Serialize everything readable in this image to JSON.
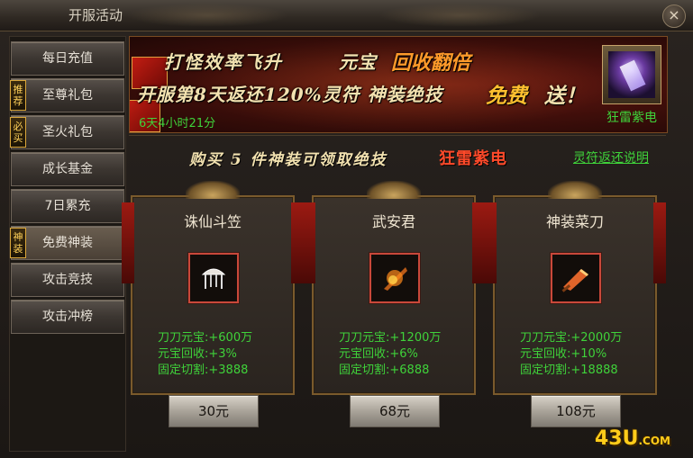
{
  "window": {
    "title": "开服活动",
    "close_glyph": "×"
  },
  "sidebar": {
    "items": [
      {
        "label": "每日充值",
        "badge": ""
      },
      {
        "label": "至尊礼包",
        "badge": "推荐"
      },
      {
        "label": "圣火礼包",
        "badge": "必买"
      },
      {
        "label": "成长基金",
        "badge": ""
      },
      {
        "label": "7日累充",
        "badge": ""
      },
      {
        "label": "免费神装",
        "badge": "神装"
      },
      {
        "label": "攻击竞技",
        "badge": ""
      },
      {
        "label": "攻击冲榜",
        "badge": ""
      }
    ]
  },
  "banner": {
    "line1_a": "打怪效率飞升",
    "line1_b": "元宝",
    "line1_c": "回收翻倍",
    "line2_a": "开服第8天返还120%灵符  神装绝技",
    "line2_b": "免费",
    "line2_c": "送！",
    "countdown": "6天4小时21分",
    "reward_name": "狂雷紫电",
    "reward_icon": "purple-crystal-icon"
  },
  "offer": {
    "line": "购买 5 件神装可领取绝技",
    "highlight": "狂雷紫电",
    "explain_link": "灵符返还说明"
  },
  "cards": [
    {
      "name": "诛仙斗笠",
      "icon": "hat-icon",
      "stats": [
        "刀刀元宝:+600万",
        "元宝回收:+3%",
        "固定切割:+3888"
      ],
      "price": "30元"
    },
    {
      "name": "武安君",
      "icon": "fire-weapon-icon",
      "stats": [
        "刀刀元宝:+1200万",
        "元宝回收:+6%",
        "固定切割:+6888"
      ],
      "price": "68元"
    },
    {
      "name": "神装菜刀",
      "icon": "cleaver-icon",
      "stats": [
        "刀刀元宝:+2000万",
        "元宝回收:+10%",
        "固定切割:+18888"
      ],
      "price": "108元"
    }
  ],
  "watermark": {
    "main": "43U",
    "suffix": ".COM"
  },
  "colors": {
    "green_text": "#3fd23a",
    "gold": "#f3e2b0",
    "accent_red": "#ff4a2a"
  }
}
